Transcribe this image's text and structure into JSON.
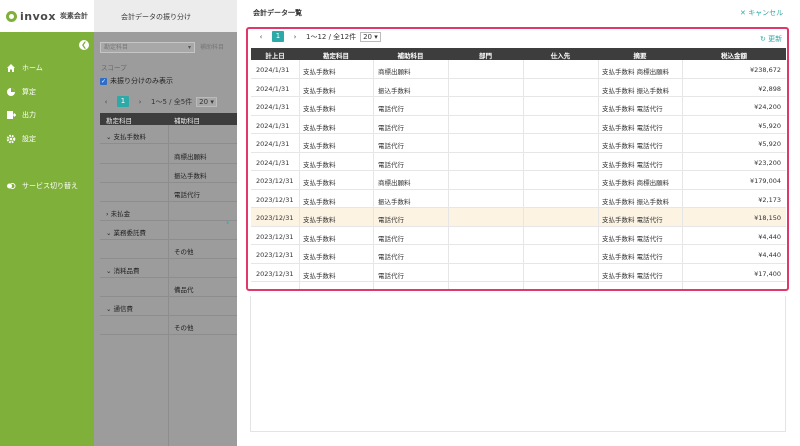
{
  "brand": {
    "name": "invox",
    "suffix": "炭素会計"
  },
  "sidebar": {
    "collapse": "❮",
    "items": [
      {
        "label": "ホーム",
        "icon": "home-icon"
      },
      {
        "label": "算定",
        "icon": "calculation-icon"
      },
      {
        "label": "出力",
        "icon": "export-icon"
      },
      {
        "label": "設定",
        "icon": "gear-icon"
      },
      {
        "label": "サービス切り替え",
        "icon": "switch-icon"
      }
    ]
  },
  "left_panel": {
    "page_title": "会計データの振り分け",
    "select_placeholder": "勘定科目",
    "select2_label": "補助科目",
    "scope_label": "スコープ",
    "unassigned_only": "未振り分けのみ表示",
    "pager": {
      "prev": "‹",
      "current": "1",
      "next": "›",
      "info": "1〜5 / 全5件",
      "size": "20"
    },
    "columns": [
      "勘定科目",
      "補助科目"
    ],
    "rows": [
      {
        "cat": "⌄ 支払手数料",
        "sub": ""
      },
      {
        "cat": "",
        "sub": "商標出願料"
      },
      {
        "cat": "",
        "sub": "振込手数料"
      },
      {
        "cat": "",
        "sub": "電話代行"
      },
      {
        "cat": "› 未払金",
        "sub": ""
      },
      {
        "cat": "⌄ 業務委託費",
        "sub": ""
      },
      {
        "cat": "",
        "sub": "その他"
      },
      {
        "cat": "⌄ 消耗品費",
        "sub": ""
      },
      {
        "cat": "",
        "sub": "備品代"
      },
      {
        "cat": "⌄ 通信費",
        "sub": ""
      },
      {
        "cat": "",
        "sub": "その他"
      }
    ],
    "expand_handle": "›"
  },
  "main": {
    "title": "会計データ一覧",
    "cancel": "✕ キャンセル",
    "refresh": "↻ 更新",
    "pager": {
      "prev": "‹",
      "current": "1",
      "next": "›",
      "info": "1〜12 / 全12件",
      "size": "20"
    },
    "columns": [
      "計上日",
      "勘定科目",
      "補助科目",
      "部門",
      "仕入先",
      "摘要",
      "税込金額"
    ],
    "rows": [
      {
        "date": "2024/1/31",
        "account": "支払手数料",
        "sub": "商標出願料",
        "dept": "",
        "vendor": "",
        "memo": "支払手数料 商標出願料",
        "amount": "¥238,672"
      },
      {
        "date": "2024/1/31",
        "account": "支払手数料",
        "sub": "振込手数料",
        "dept": "",
        "vendor": "",
        "memo": "支払手数料 振込手数料",
        "amount": "¥2,898"
      },
      {
        "date": "2024/1/31",
        "account": "支払手数料",
        "sub": "電話代行",
        "dept": "",
        "vendor": "",
        "memo": "支払手数料 電話代行",
        "amount": "¥24,200"
      },
      {
        "date": "2024/1/31",
        "account": "支払手数料",
        "sub": "電話代行",
        "dept": "",
        "vendor": "",
        "memo": "支払手数料 電話代行",
        "amount": "¥5,920"
      },
      {
        "date": "2024/1/31",
        "account": "支払手数料",
        "sub": "電話代行",
        "dept": "",
        "vendor": "",
        "memo": "支払手数料 電話代行",
        "amount": "¥5,920"
      },
      {
        "date": "2024/1/31",
        "account": "支払手数料",
        "sub": "電話代行",
        "dept": "",
        "vendor": "",
        "memo": "支払手数料 電話代行",
        "amount": "¥23,200"
      },
      {
        "date": "2023/12/31",
        "account": "支払手数料",
        "sub": "商標出願料",
        "dept": "",
        "vendor": "",
        "memo": "支払手数料 商標出願料",
        "amount": "¥179,004"
      },
      {
        "date": "2023/12/31",
        "account": "支払手数料",
        "sub": "振込手数料",
        "dept": "",
        "vendor": "",
        "memo": "支払手数料 振込手数料",
        "amount": "¥2,173"
      },
      {
        "date": "2023/12/31",
        "account": "支払手数料",
        "sub": "電話代行",
        "dept": "",
        "vendor": "",
        "memo": "支払手数料 電話代行",
        "amount": "¥18,150"
      },
      {
        "date": "2023/12/31",
        "account": "支払手数料",
        "sub": "電話代行",
        "dept": "",
        "vendor": "",
        "memo": "支払手数料 電話代行",
        "amount": "¥4,440"
      },
      {
        "date": "2023/12/31",
        "account": "支払手数料",
        "sub": "電話代行",
        "dept": "",
        "vendor": "",
        "memo": "支払手数料 電話代行",
        "amount": "¥4,440"
      },
      {
        "date": "2023/12/31",
        "account": "支払手数料",
        "sub": "電話代行",
        "dept": "",
        "vendor": "",
        "memo": "支払手数料 電話代行",
        "amount": "¥17,400"
      }
    ],
    "highlight_row": 8
  },
  "colors": {
    "brand_green": "#7fb03a",
    "accent_teal": "#2da9a8",
    "dialog_border": "#e0386a",
    "header_dark": "#3d3d3d"
  }
}
